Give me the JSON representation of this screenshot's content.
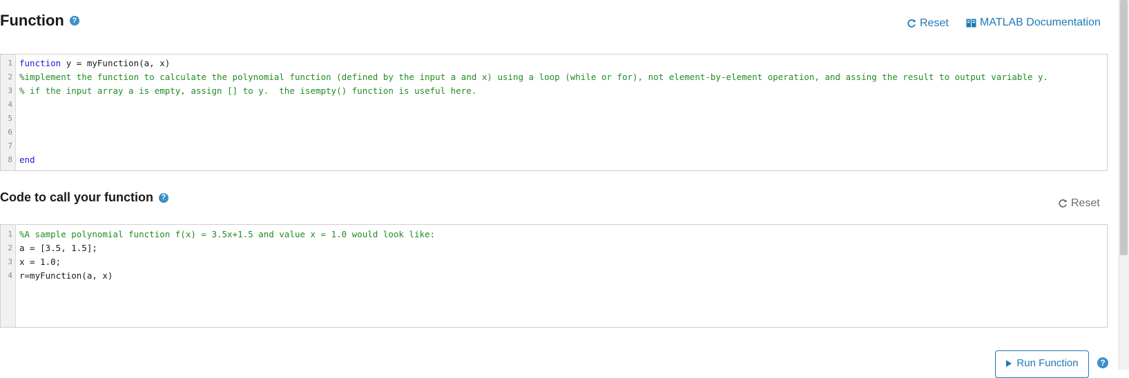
{
  "function_section": {
    "title": "Function",
    "reset_label": "Reset",
    "docs_label": "MATLAB Documentation",
    "editor_lines": [
      {
        "num": "1",
        "parts": [
          {
            "t": "function",
            "c": "kw"
          },
          {
            "t": " y = myFunction(a, x)",
            "c": ""
          }
        ]
      },
      {
        "num": "2",
        "parts": [
          {
            "t": "%implement the function to calculate the polynomial function (defined by the input a and x) using a loop (while or for), not element-by-element operation, and assing the result to output variable y.",
            "c": "cm"
          }
        ]
      },
      {
        "num": "3",
        "parts": [
          {
            "t": "% if the input array a is empty, assign [] to y.  the isempty() function is useful here.",
            "c": "cm"
          }
        ]
      },
      {
        "num": "4",
        "parts": []
      },
      {
        "num": "5",
        "parts": []
      },
      {
        "num": "6",
        "parts": []
      },
      {
        "num": "7",
        "parts": []
      },
      {
        "num": "8",
        "parts": [
          {
            "t": "end",
            "c": "kw"
          }
        ]
      }
    ]
  },
  "call_section": {
    "title": "Code to call your function",
    "reset_label": "Reset",
    "editor_lines": [
      {
        "num": "1",
        "parts": [
          {
            "t": "%A sample polynomial function f(x) = 3.5x+1.5 and value x = 1.0 would look like:",
            "c": "cm"
          }
        ]
      },
      {
        "num": "2",
        "parts": [
          {
            "t": "a = [3.5, 1.5];",
            "c": ""
          }
        ]
      },
      {
        "num": "3",
        "parts": [
          {
            "t": "x = 1.0;",
            "c": ""
          }
        ]
      },
      {
        "num": "4",
        "parts": [
          {
            "t": "r=myFunction(a, x)",
            "c": ""
          }
        ]
      }
    ]
  },
  "footer": {
    "run_label": "Run Function"
  },
  "icons": {
    "help": "question-circle-icon",
    "reset": "refresh-icon",
    "docs": "book-icon",
    "run": "play-icon"
  },
  "colors": {
    "accent": "#1f78b4",
    "help_icon": "#3d8fc7",
    "keyword": "#1a1ad6",
    "comment": "#228b22"
  }
}
